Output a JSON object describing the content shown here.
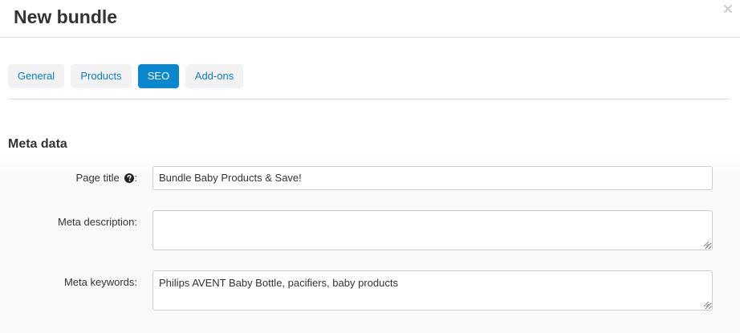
{
  "dialog": {
    "title": "New bundle",
    "close_icon": "close-icon"
  },
  "tabs": [
    {
      "label": "General",
      "active": false
    },
    {
      "label": "Products",
      "active": false
    },
    {
      "label": "SEO",
      "active": true
    },
    {
      "label": "Add-ons",
      "active": false
    }
  ],
  "section": {
    "title": "Meta data"
  },
  "fields": {
    "page_title": {
      "label": "Page title",
      "suffix": ":",
      "help_icon": "question-circle-icon",
      "value": "Bundle Baby Products & Save!"
    },
    "meta_description": {
      "label": "Meta description:",
      "value": ""
    },
    "meta_keywords": {
      "label": "Meta keywords:",
      "value": "Philips AVENT Baby Bottle, pacifiers, baby products"
    }
  },
  "colors": {
    "accent": "#0b87cf",
    "tab_text": "#0a7dc4",
    "tab_bg": "#f2f2f2"
  }
}
